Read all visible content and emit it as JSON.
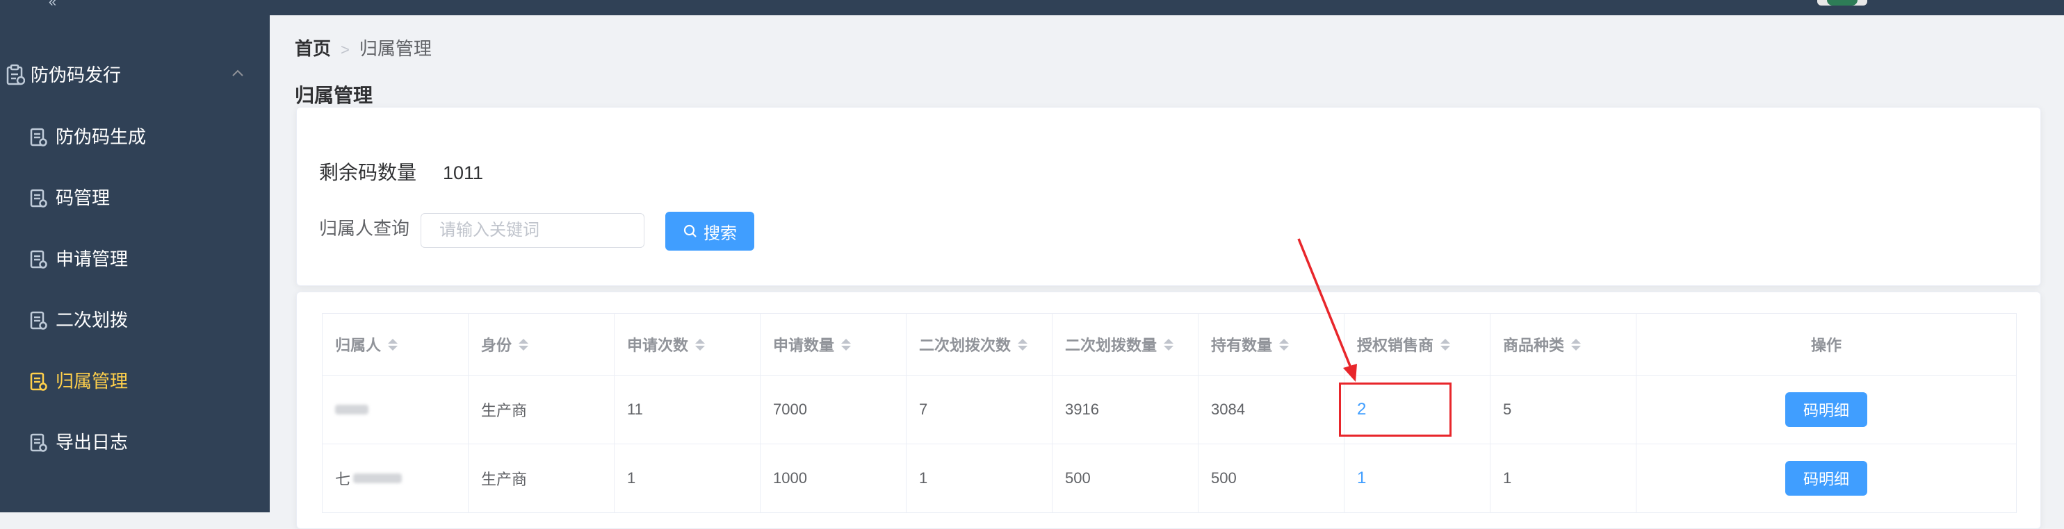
{
  "sidebar": {
    "group": {
      "label": "防伪码发行"
    },
    "items": [
      {
        "label": "防伪码生成",
        "active": false
      },
      {
        "label": "码管理",
        "active": false
      },
      {
        "label": "申请管理",
        "active": false
      },
      {
        "label": "二次划拨",
        "active": false
      },
      {
        "label": "归属管理",
        "active": true
      },
      {
        "label": "导出日志",
        "active": false
      }
    ],
    "colors": {
      "background": "#304156",
      "active_text": "#ffd04b"
    }
  },
  "breadcrumb": {
    "home": "首页",
    "current": "归属管理"
  },
  "page_title": "归属管理",
  "summary": {
    "remaining_label": "剩余码数量",
    "remaining_value": "1011"
  },
  "search": {
    "label": "归属人查询",
    "placeholder": "请输入关键词",
    "value": "",
    "button_label": "搜索"
  },
  "table": {
    "columns": [
      "归属人",
      "身份",
      "申请次数",
      "申请数量",
      "二次划拨次数",
      "二次划拨数量",
      "持有数量",
      "授权销售商",
      "商品种类",
      "操作"
    ],
    "rows": [
      {
        "owner": "",
        "role": "生产商",
        "apply_count": "11",
        "apply_qty": "7000",
        "transfer_count": "7",
        "transfer_qty": "3916",
        "hold_qty": "3084",
        "dealers": "2",
        "categories": "5",
        "action": "码明细"
      },
      {
        "owner": "七",
        "role": "生产商",
        "apply_count": "1",
        "apply_qty": "1000",
        "transfer_count": "1",
        "transfer_qty": "500",
        "hold_qty": "500",
        "dealers": "1",
        "categories": "1",
        "action": "码明细"
      }
    ]
  },
  "colors": {
    "primary": "#409eff",
    "annotation": "#e8262b"
  }
}
